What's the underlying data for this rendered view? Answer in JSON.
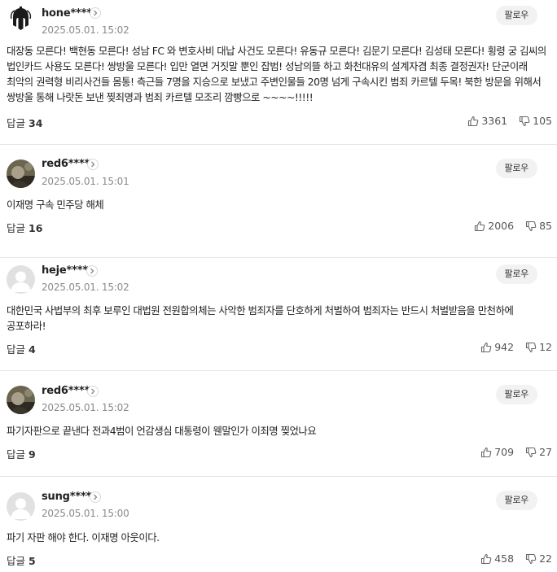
{
  "labels": {
    "follow": "팔로우",
    "reply": "답글"
  },
  "comments": [
    {
      "username": "hone****",
      "date": "2025.05.01. 15:02",
      "text": "대장동 모른다! 백현동 모른다! 성남 FC 와 변호사비 대납 사건도 모른다! 유동규 모른다! 김문기 모른다! 김성태 모른다! 횡령 궁 김씨의 법인카드 사용도 모른다! 쌍방울 모른다! 입만 열면 거짓말 뿐인 잡범! 성남의뜰 하고 화천대유의 설계자겸 최종 결정권자! 단군이래 최악의 권력형 비리사건들 몸통! 측근들 7명을 지승으로 보냈고 주변인물들 20명 넘게 구속시킨 범죄 카르텔 두목! 북한 방문을 위해서 쌍방울 통해 나랏돈 보낸 찢죄명과 범죄 카르텔 모조리 깜빵으로 ~~~~!!!!!",
      "replies": "34",
      "likes": "3361",
      "dislikes": "105",
      "avatar": "spartan-helmet-avatar"
    },
    {
      "username": "red6****",
      "date": "2025.05.01. 15:01",
      "text": "이재명 구속 민주당 해체",
      "replies": "16",
      "likes": "2006",
      "dislikes": "85",
      "avatar": "photo-avatar"
    },
    {
      "username": "heje****",
      "date": "2025.05.01. 15:02",
      "text": "대한민국 사법부의 최후 보루인 대법원 전원합의체는 사악한 범죄자를 단호하게 처벌하여 범죄자는 반드시 처벌받음을 만천하에 공포하라!",
      "replies": "4",
      "likes": "942",
      "dislikes": "12",
      "avatar": "default-avatar"
    },
    {
      "username": "red6****",
      "date": "2025.05.01. 15:02",
      "text": "파기자판으로 끝낸다 전과4범이 언감생심 대통령이 웬말인가 이죄명 찢었나요",
      "replies": "9",
      "likes": "709",
      "dislikes": "27",
      "avatar": "photo-avatar"
    },
    {
      "username": "sung****",
      "date": "2025.05.01. 15:00",
      "text": "파기 자판 해야 한다. 이재명 아웃이다.",
      "replies": "5",
      "likes": "458",
      "dislikes": "22",
      "avatar": "default-avatar"
    }
  ]
}
